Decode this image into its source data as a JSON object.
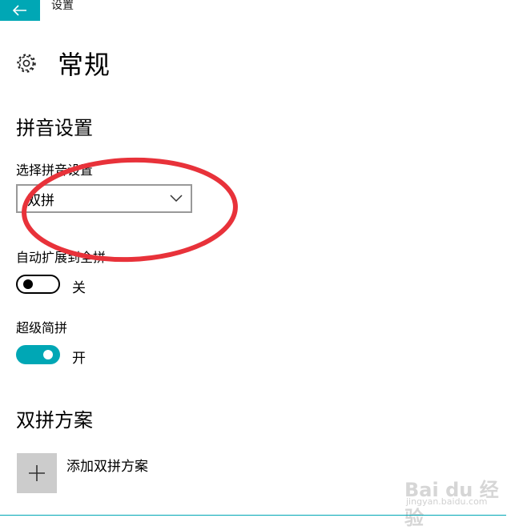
{
  "window": {
    "title": "设置",
    "back_icon": "arrow-left-icon"
  },
  "page": {
    "title": "常规",
    "icon": "gear-icon"
  },
  "pinyin_settings": {
    "section_title": "拼音设置",
    "select_label": "选择拼音设置",
    "select_value": "双拼",
    "auto_expand": {
      "label": "自动扩展到全拼",
      "state": "关",
      "on": false
    },
    "super_abbrev": {
      "label": "超级简拼",
      "state": "开",
      "on": true
    }
  },
  "shuangpin_scheme": {
    "section_title": "双拼方案",
    "add_label": "添加双拼方案",
    "add_icon": "plus-icon"
  },
  "watermark": {
    "text": "Bai du 经验",
    "url": "jingyan.baidu.com"
  },
  "colors": {
    "accent": "#00a7b5",
    "annotation": "#e8323a",
    "tile": "#cccccc"
  }
}
